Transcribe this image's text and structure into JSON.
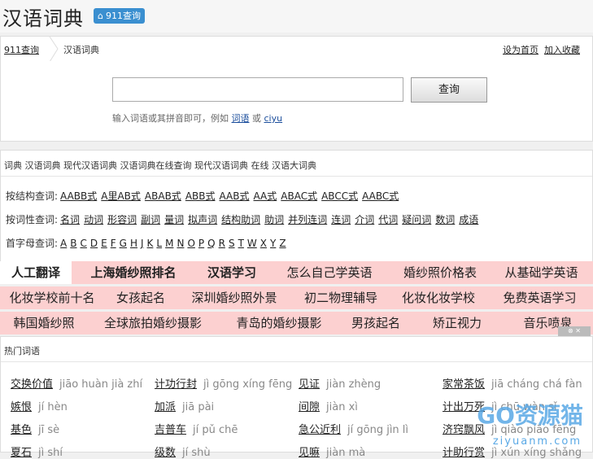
{
  "header": {
    "logo": "汉语词典",
    "badge": "911查询"
  },
  "breadcrumb": {
    "home": "911查询",
    "current": "汉语词典",
    "set_home": "设为首页",
    "add_fav": "加入收藏"
  },
  "search": {
    "value": "",
    "placeholder": "",
    "button": "查询",
    "hint_prefix": "输入词语或其拼音即可，例如 ",
    "hint_word": "词语",
    "hint_or": " 或 ",
    "hint_pinyin": "ciyu"
  },
  "links": "词典 汉语词典 现代汉语词典 汉语词典在线查询 现代汉语词典 在线 汉语大词典",
  "by_structure": {
    "label": "按结构查词:",
    "items": [
      "AABB式",
      "A里AB式",
      "ABAB式",
      "ABB式",
      "AAB式",
      "AA式",
      "ABAC式",
      "ABCC式",
      "AABC式"
    ]
  },
  "by_pos": {
    "label": "按词性查词:",
    "items": [
      "名词",
      "动词",
      "形容词",
      "副词",
      "量词",
      "拟声词",
      "结构助词",
      "助词",
      "并列连词",
      "连词",
      "介词",
      "代词",
      "疑问词",
      "数词",
      "成语"
    ]
  },
  "by_initial": {
    "label": "首字母查词:",
    "items": [
      "A",
      "B",
      "C",
      "D",
      "E",
      "F",
      "G",
      "H",
      "J",
      "K",
      "L",
      "M",
      "N",
      "O",
      "P",
      "Q",
      "R",
      "S",
      "T",
      "W",
      "X",
      "Y",
      "Z"
    ]
  },
  "ads": [
    [
      "人工翻译",
      "上海婚纱照排名",
      "汉语学习",
      "怎么自己学英语",
      "婚纱照价格表",
      "从基础学英语"
    ],
    [
      "化妆学校前十名",
      "女孩起名",
      "深圳婚纱照外景",
      "初二物理辅导",
      "化妆化妆学校",
      "免费英语学习"
    ],
    [
      "韩国婚纱照",
      "全球旅拍婚纱摄影",
      "青岛的婚纱摄影",
      "男孩起名",
      "矫正视力",
      "音乐喷泉"
    ]
  ],
  "hot": {
    "title": "热门词语",
    "rows": [
      [
        [
          "交换价值",
          "jiāo huàn jià zhí"
        ],
        [
          "计功行封",
          "jì gōng xíng fēng"
        ],
        [
          "见证",
          "jiàn zhèng"
        ],
        [
          "家常茶饭",
          "jiā cháng chá fàn"
        ]
      ],
      [
        [
          "嫉恨",
          "jí hèn"
        ],
        [
          "加派",
          "jiā pài"
        ],
        [
          "间隙",
          "jiàn xì"
        ],
        [
          "计出万死",
          "jì chū wàn sǐ"
        ]
      ],
      [
        [
          "基色",
          "jī sè"
        ],
        [
          "吉普车",
          "jí pǔ chē"
        ],
        [
          "急公近利",
          "jí gōng jìn lì"
        ],
        [
          "济窍飘风",
          "jì qiào piāo fēng"
        ]
      ],
      [
        [
          "夏石",
          "jì shí"
        ],
        [
          "级数",
          "jí shù"
        ],
        [
          "见嘛",
          "jiàn mà"
        ],
        [
          "计助行赏",
          "jì xún xíng shǎng"
        ]
      ]
    ]
  },
  "watermark": {
    "main": "GO资源猫",
    "sub": "ziyuanm.com"
  }
}
